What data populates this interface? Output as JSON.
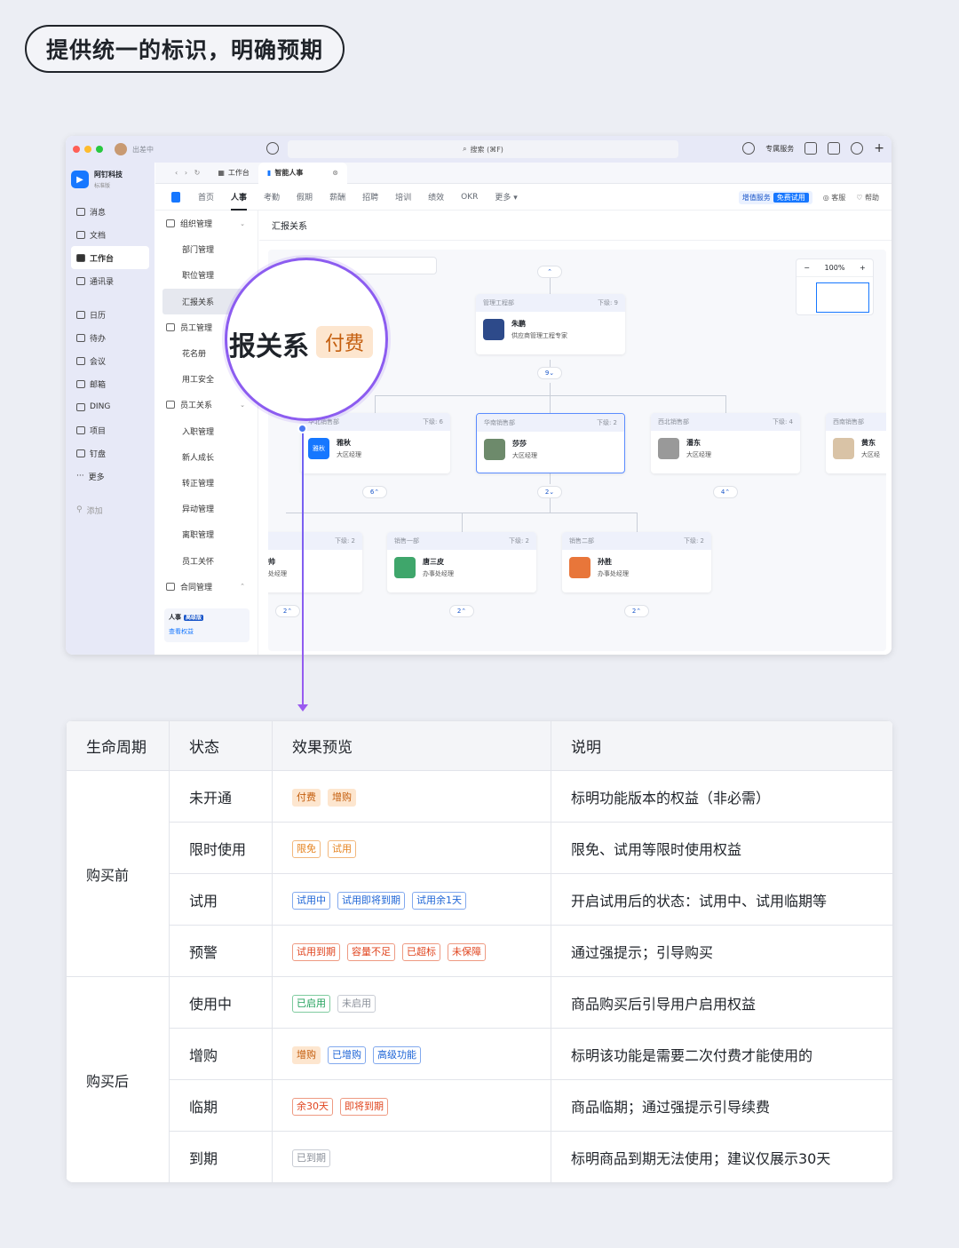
{
  "heading": "提供统一的标识，明确预期",
  "colors": {
    "accent": "#1677ff",
    "lens": "#8c5cf0",
    "paid_badge_bg": "#fde6cf",
    "paid_badge_fg": "#c45e0e"
  },
  "titlebar": {
    "status": "出差中",
    "search": "搜索 (⌘F)",
    "exclusive": "专属服务"
  },
  "org": {
    "name": "阿钉科技",
    "edition": "标准版"
  },
  "nav": [
    "消息",
    "文档",
    "工作台",
    "通讯录",
    "日历",
    "待办",
    "会议",
    "邮箱",
    "DING",
    "项目",
    "钉盘",
    "更多",
    "添加"
  ],
  "tabs": {
    "workspace": "工作台",
    "smart_hr": "智能人事"
  },
  "menu": {
    "items": [
      "首页",
      "人事",
      "考勤",
      "假期",
      "薪酬",
      "招聘",
      "培训",
      "绩效",
      "OKR",
      "更多"
    ],
    "value_added": "增值服务",
    "free_trial": "免费试用",
    "support": "客服",
    "help": "帮助"
  },
  "sub_menu": [
    "组织管理",
    "部门管理",
    "职位管理",
    "汇报关系",
    "员工管理",
    "花名册",
    "用工安全",
    "员工关系",
    "入职管理",
    "新人成长",
    "转正管理",
    "异动管理",
    "离职管理",
    "员工关怀",
    "合同管理"
  ],
  "upsell": {
    "title": "人事",
    "tier": "高级版",
    "link": "查看权益"
  },
  "content": {
    "title": "汇报关系",
    "zoom": "100%"
  },
  "org_chart": {
    "root": {
      "dept": "管理工程部",
      "sub": "下级: 9",
      "name": "朱鹏",
      "role": "供应商管理工程专家"
    },
    "root_count": "9",
    "level2": [
      {
        "dept": "华北销售部",
        "sub": "下级: 6",
        "name": "雅秋",
        "role": "大区经理",
        "avatar_text": "雅秋",
        "count": "6"
      },
      {
        "dept": "华南销售部",
        "sub": "下级: 2",
        "name": "莎莎",
        "role": "大区经理",
        "count": "2"
      },
      {
        "dept": "西北销售部",
        "sub": "下级: 4",
        "name": "潘东",
        "role": "大区经理",
        "count": "4"
      },
      {
        "dept": "西南销售部",
        "sub": "",
        "name": "黄东",
        "role": "大区经",
        "count": ""
      }
    ],
    "level3": [
      {
        "dept": "",
        "sub": "下级: 2",
        "name": "帅",
        "role": "处经理",
        "count": "2"
      },
      {
        "dept": "销售一部",
        "sub": "下级: 2",
        "name": "唐三皮",
        "role": "办事处经理",
        "count": "2"
      },
      {
        "dept": "销售二部",
        "sub": "下级: 2",
        "name": "孙胜",
        "role": "办事处经理",
        "count": "2"
      }
    ]
  },
  "lens": {
    "text": "报关系",
    "badge": "付费"
  },
  "table": {
    "headers": [
      "生命周期",
      "状态",
      "效果预览",
      "说明"
    ],
    "groups": {
      "before": "购买前",
      "after": "购买后"
    },
    "rows": [
      {
        "state": "未开通",
        "tags": [
          {
            "t": "付费",
            "s": "fill-orange"
          },
          {
            "t": "增购",
            "s": "fill-orange"
          }
        ],
        "desc": "标明功能版本的权益（非必需）"
      },
      {
        "state": "限时使用",
        "tags": [
          {
            "t": "限免",
            "s": "orange"
          },
          {
            "t": "试用",
            "s": "orange"
          }
        ],
        "desc": "限免、试用等限时使用权益"
      },
      {
        "state": "试用",
        "tags": [
          {
            "t": "试用中",
            "s": "blue"
          },
          {
            "t": "试用即将到期",
            "s": "blue"
          },
          {
            "t": "试用余1天",
            "s": "blue"
          }
        ],
        "desc": "开启试用后的状态：试用中、试用临期等"
      },
      {
        "state": "预警",
        "tags": [
          {
            "t": "试用到期",
            "s": "red"
          },
          {
            "t": "容量不足",
            "s": "red"
          },
          {
            "t": "已超标",
            "s": "red"
          },
          {
            "t": "未保障",
            "s": "red"
          }
        ],
        "desc": "通过强提示；引导购买"
      },
      {
        "state": "使用中",
        "tags": [
          {
            "t": "已启用",
            "s": "green"
          },
          {
            "t": "未启用",
            "s": "grey"
          }
        ],
        "desc": "商品购买后引导用户启用权益"
      },
      {
        "state": "增购",
        "tags": [
          {
            "t": "增购",
            "s": "fill-orange"
          },
          {
            "t": "已增购",
            "s": "blue"
          },
          {
            "t": "高级功能",
            "s": "blue"
          }
        ],
        "desc": "标明该功能是需要二次付费才能使用的"
      },
      {
        "state": "临期",
        "tags": [
          {
            "t": "余30天",
            "s": "red"
          },
          {
            "t": "即将到期",
            "s": "red"
          }
        ],
        "desc": "商品临期；通过强提示引导续费"
      },
      {
        "state": "到期",
        "tags": [
          {
            "t": "已到期",
            "s": "grey"
          }
        ],
        "desc": "标明商品到期无法使用；建议仅展示30天"
      }
    ]
  }
}
